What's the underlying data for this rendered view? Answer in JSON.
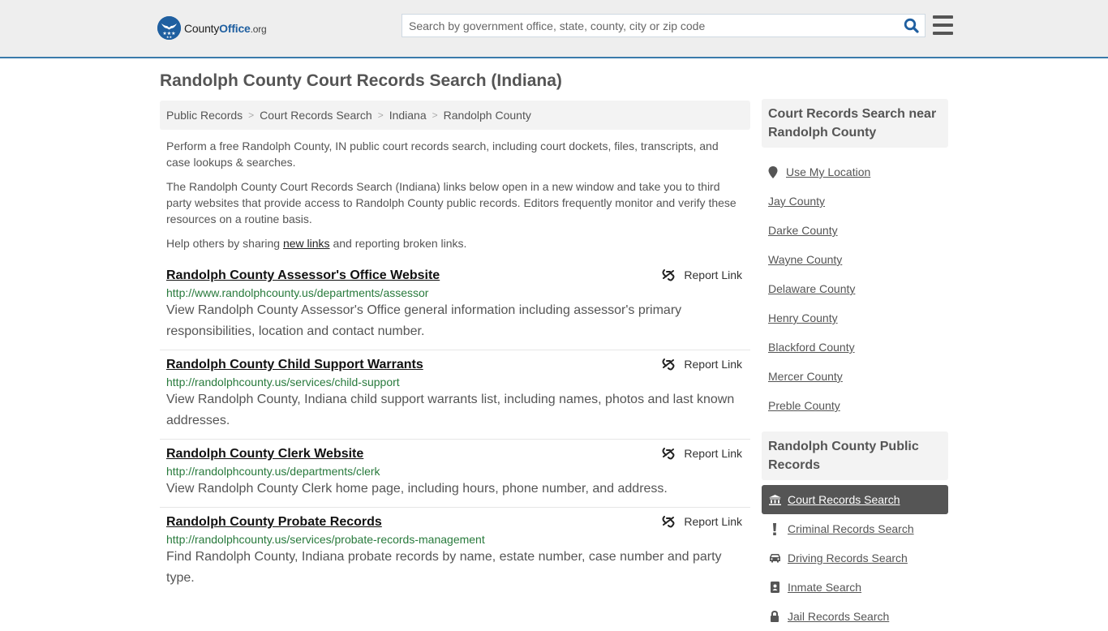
{
  "header": {
    "logo": {
      "county": "County",
      "office": "Office",
      "org": ".org"
    },
    "search": {
      "placeholder": "Search by government office, state, county, city or zip code",
      "value": ""
    },
    "colors": {
      "brand": "#1f5fa0",
      "header_border": "#3a7bab",
      "url_green": "#287a3c"
    }
  },
  "page": {
    "title": "Randolph County Court Records Search (Indiana)"
  },
  "breadcrumb": [
    {
      "label": "Public Records"
    },
    {
      "label": "Court Records Search"
    },
    {
      "label": "Indiana"
    },
    {
      "label": "Randolph County"
    }
  ],
  "intro": {
    "p1": "Perform a free Randolph County, IN public court records search, including court dockets, files, transcripts, and case lookups & searches.",
    "p2": "The Randolph County Court Records Search (Indiana) links below open in a new window and take you to third party websites that provide access to Randolph County public records. Editors frequently monitor and verify these resources on a routine basis.",
    "p3_before": "Help others by sharing ",
    "p3_link": "new links",
    "p3_after": " and reporting broken links."
  },
  "results": [
    {
      "title": "Randolph County Assessor's Office Website",
      "url": "http://www.randolphcounty.us/departments/assessor",
      "description": "View Randolph County Assessor's Office general information including assessor's primary responsibilities, location and contact number.",
      "report_label": "Report Link"
    },
    {
      "title": "Randolph County Child Support Warrants",
      "url": "http://randolphcounty.us/services/child-support",
      "description": "View Randolph County, Indiana child support warrants list, including names, photos and last known addresses.",
      "report_label": "Report Link"
    },
    {
      "title": "Randolph County Clerk Website",
      "url": "http://randolphcounty.us/departments/clerk",
      "description": "View Randolph County Clerk home page, including hours, phone number, and address.",
      "report_label": "Report Link"
    },
    {
      "title": "Randolph County Probate Records",
      "url": "http://randolphcounty.us/services/probate-records-management",
      "description": "Find Randolph County, Indiana probate records by name, estate number, case number and party type.",
      "report_label": "Report Link"
    }
  ],
  "sidebar": {
    "nearby_heading": "Court Records Search near Randolph County",
    "use_location": "Use My Location",
    "nearby": [
      {
        "label": "Jay County"
      },
      {
        "label": "Darke County"
      },
      {
        "label": "Wayne County"
      },
      {
        "label": "Delaware County"
      },
      {
        "label": "Henry County"
      },
      {
        "label": "Blackford County"
      },
      {
        "label": "Mercer County"
      },
      {
        "label": "Preble County"
      }
    ],
    "public_records_heading": "Randolph County Public Records",
    "public_records": [
      {
        "label": "Court Records Search",
        "icon": "courthouse-icon",
        "active": true
      },
      {
        "label": "Criminal Records Search",
        "icon": "exclamation-icon",
        "active": false
      },
      {
        "label": "Driving Records Search",
        "icon": "car-icon",
        "active": false
      },
      {
        "label": "Inmate Search",
        "icon": "id-badge-icon",
        "active": false
      },
      {
        "label": "Jail Records Search",
        "icon": "lock-icon",
        "active": false
      }
    ]
  }
}
